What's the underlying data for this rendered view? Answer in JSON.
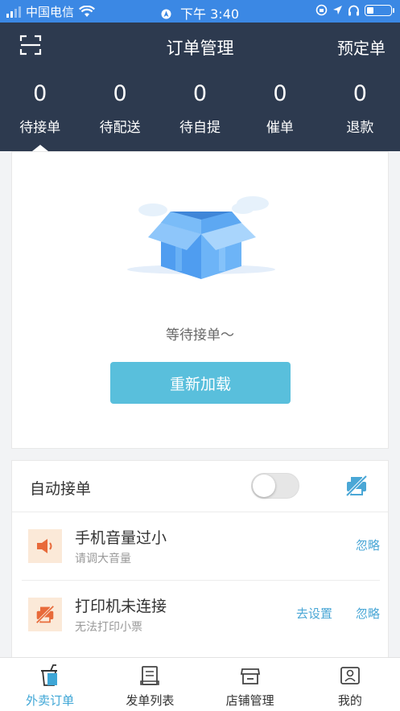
{
  "status_bar": {
    "carrier": "中国电信",
    "time": "下午 3:40"
  },
  "header": {
    "title": "订单管理",
    "booking_label": "预定单",
    "stats": [
      {
        "count": "0",
        "label": "待接单"
      },
      {
        "count": "0",
        "label": "待配送"
      },
      {
        "count": "0",
        "label": "待自提"
      },
      {
        "count": "0",
        "label": "催单"
      },
      {
        "count": "0",
        "label": "退款"
      }
    ]
  },
  "empty_state": {
    "message": "等待接单～",
    "reload_label": "重新加载"
  },
  "settings": {
    "auto_accept_label": "自动接单",
    "auto_accept_enabled": false,
    "warnings": [
      {
        "title": "手机音量过小",
        "subtitle": "请调大音量",
        "actions": [
          "忽略"
        ],
        "icon": "speaker-icon"
      },
      {
        "title": "打印机未连接",
        "subtitle": "无法打印小票",
        "actions": [
          "去设置",
          "忽略"
        ],
        "icon": "printer-off-icon"
      }
    ]
  },
  "bottom_nav": [
    {
      "label": "外卖订单",
      "icon": "takeout-cup-icon",
      "active": true
    },
    {
      "label": "发单列表",
      "icon": "dispatch-list-icon",
      "active": false
    },
    {
      "label": "店铺管理",
      "icon": "store-icon",
      "active": false
    },
    {
      "label": "我的",
      "icon": "profile-card-icon",
      "active": false
    }
  ],
  "colors": {
    "header_bg": "#2d3a4f",
    "status_bg": "#3b88e4",
    "accent": "#59bfdc",
    "warn_bg": "#fbe9d8",
    "warn_icon": "#e86a3a"
  }
}
